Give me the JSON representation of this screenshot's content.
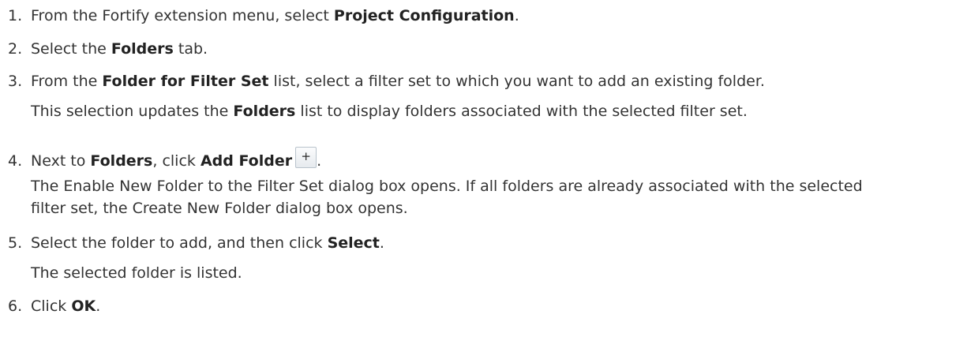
{
  "steps": [
    {
      "number": "1.",
      "text_before": "From the Fortify extension menu, select ",
      "bold": "Project Configuration",
      "text_after": "."
    },
    {
      "number": "2.",
      "text_before": "Select the ",
      "bold": "Folders",
      "text_after": " tab."
    },
    {
      "number": "3.",
      "text_before": "From the ",
      "bold": "Folder for Filter Set",
      "text_after": " list, select a filter set to which you want to add an existing folder.",
      "note_before": "This selection updates the ",
      "note_bold": "Folders",
      "note_after": " list to display folders associated with the selected filter set."
    },
    {
      "number": "4.",
      "text_before": "Next to ",
      "bold": "Folders",
      "text_middle": ", click ",
      "bold2": "Add Folder",
      "icon": "add-folder-icon",
      "text_after": ".",
      "note": "The Enable New Folder to the Filter Set dialog box opens. If all folders are already associated with the selected filter set, the Create New Folder dialog box opens."
    },
    {
      "number": "5.",
      "text_before": "Select the folder to add, and then click ",
      "bold": "Select",
      "text_after": ".",
      "note": "The selected folder is listed."
    },
    {
      "number": "6.",
      "text_before": "Click ",
      "bold": "OK",
      "text_after": "."
    }
  ]
}
